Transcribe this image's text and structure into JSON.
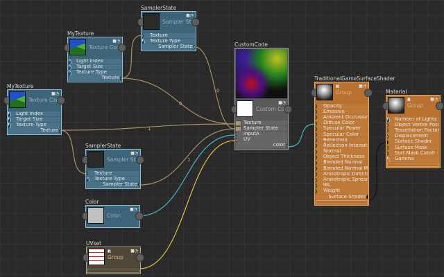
{
  "colors": {
    "background": "#2a2a2a",
    "texture_wire": "#a89060",
    "teal_wire": "#40b8c8",
    "yellow_wire": "#e0c040",
    "surface_wire": "#111111"
  },
  "nodes": [
    {
      "id": "sampler-state-1",
      "title": "SamplerState",
      "header_label": "Sampler State",
      "style": "blue",
      "thumb": "dark",
      "rows": [
        {
          "label": "Texture",
          "port": "tan"
        },
        {
          "label": "Texture Type",
          "port": "V"
        }
      ],
      "output": "Sampler State"
    },
    {
      "id": "my-texture-1",
      "title": "MyTexture",
      "header_label": "Texture Con",
      "style": "blue",
      "thumb": "texture",
      "rows": [
        {
          "label": "Light Index",
          "port": "V"
        },
        {
          "label": "Target Size",
          "port": "V"
        },
        {
          "label": "Texture Type",
          "port": "V"
        }
      ],
      "output": "Texture"
    },
    {
      "id": "my-texture-2",
      "title": "MyTexture",
      "header_label": "Texture Con",
      "style": "blue",
      "thumb": "texture",
      "rows": [
        {
          "label": "Light Index",
          "port": "V"
        },
        {
          "label": "Target Size",
          "port": "V"
        },
        {
          "label": "Texture Type",
          "port": "V"
        }
      ],
      "output": "Texture"
    },
    {
      "id": "custom-code",
      "title": "CustomCode",
      "header_label": "Custom Code",
      "style": "gray",
      "thumb": "document",
      "rows": [
        {
          "label": "Texture",
          "port": "tansq"
        },
        {
          "label": "Sampler State",
          "port": "tansq"
        },
        {
          "label": "inputA",
          "port": "teal"
        },
        {
          "label": "UV",
          "port": "yellow"
        }
      ],
      "output": "color"
    },
    {
      "id": "traditional-game-surface-shader",
      "title": "TraditionalGameSurfaceShader",
      "header_label": "Group",
      "style": "orange",
      "thumb": "sphere",
      "r_mark": "R",
      "rows": [
        {
          "label": "Opacity",
          "port": "green"
        },
        {
          "label": "Emissive",
          "port": "teal"
        },
        {
          "label": "Ambient Occlusion",
          "port": "green"
        },
        {
          "label": "Diffuse Color",
          "port": "teal"
        },
        {
          "label": "Specular Power",
          "port": "green"
        },
        {
          "label": "Specular Color",
          "port": "teal"
        },
        {
          "label": "Reflection",
          "port": "teal"
        },
        {
          "label": "Reflection Intensity",
          "port": "green"
        },
        {
          "label": "Normal",
          "port": "teal"
        },
        {
          "label": "Object Thickness",
          "port": "green"
        },
        {
          "label": "Blended Normal",
          "port": "green"
        },
        {
          "label": "Blended Normal Mask",
          "port": "green"
        },
        {
          "label": "Anisotropic Direction",
          "port": "teal"
        },
        {
          "label": "Anisotropic Spread",
          "port": "yellow"
        },
        {
          "label": "IBL",
          "port": "teal"
        },
        {
          "label": "Weight",
          "port": "green"
        }
      ],
      "output": "Surface Shader"
    },
    {
      "id": "material",
      "title": "Material",
      "header_label": "Group",
      "style": "orange",
      "thumb": "sphere",
      "r_mark": "R",
      "rows": [
        {
          "label": "Number of Lights",
          "port": "V"
        },
        {
          "label": "Object Vertex Position",
          "port": "teal"
        },
        {
          "label": "Tessellation Factor",
          "port": "green"
        },
        {
          "label": "Displacement",
          "port": "teal"
        },
        {
          "label": "Surface Shader",
          "port": "black"
        },
        {
          "label": "Surface Mask",
          "port": "green"
        },
        {
          "label": "Surf Mask Cutoff",
          "port": "green"
        },
        {
          "label": "Gamma",
          "port": "Vorange"
        }
      ],
      "output": ""
    },
    {
      "id": "sampler-state-2",
      "title": "SamplerState",
      "header_label": "Sampler State",
      "style": "blue",
      "thumb": "dark",
      "rows": [
        {
          "label": "Texture",
          "port": "tan"
        },
        {
          "label": "Texture Type",
          "port": "V"
        }
      ],
      "output": "Sampler State"
    },
    {
      "id": "color",
      "title": "Color",
      "header_label": "Color",
      "style": "blue",
      "thumb": "swatch",
      "swatch_color": "#c0c0c0",
      "rows": [],
      "output": ""
    },
    {
      "id": "uvset",
      "title": "UVset",
      "header_label": "Group",
      "style": "brown",
      "thumb": "uv",
      "r_mark": "R",
      "rows": [],
      "output": ""
    }
  ],
  "wire_labels": [
    "0",
    "0",
    "1",
    "1"
  ]
}
